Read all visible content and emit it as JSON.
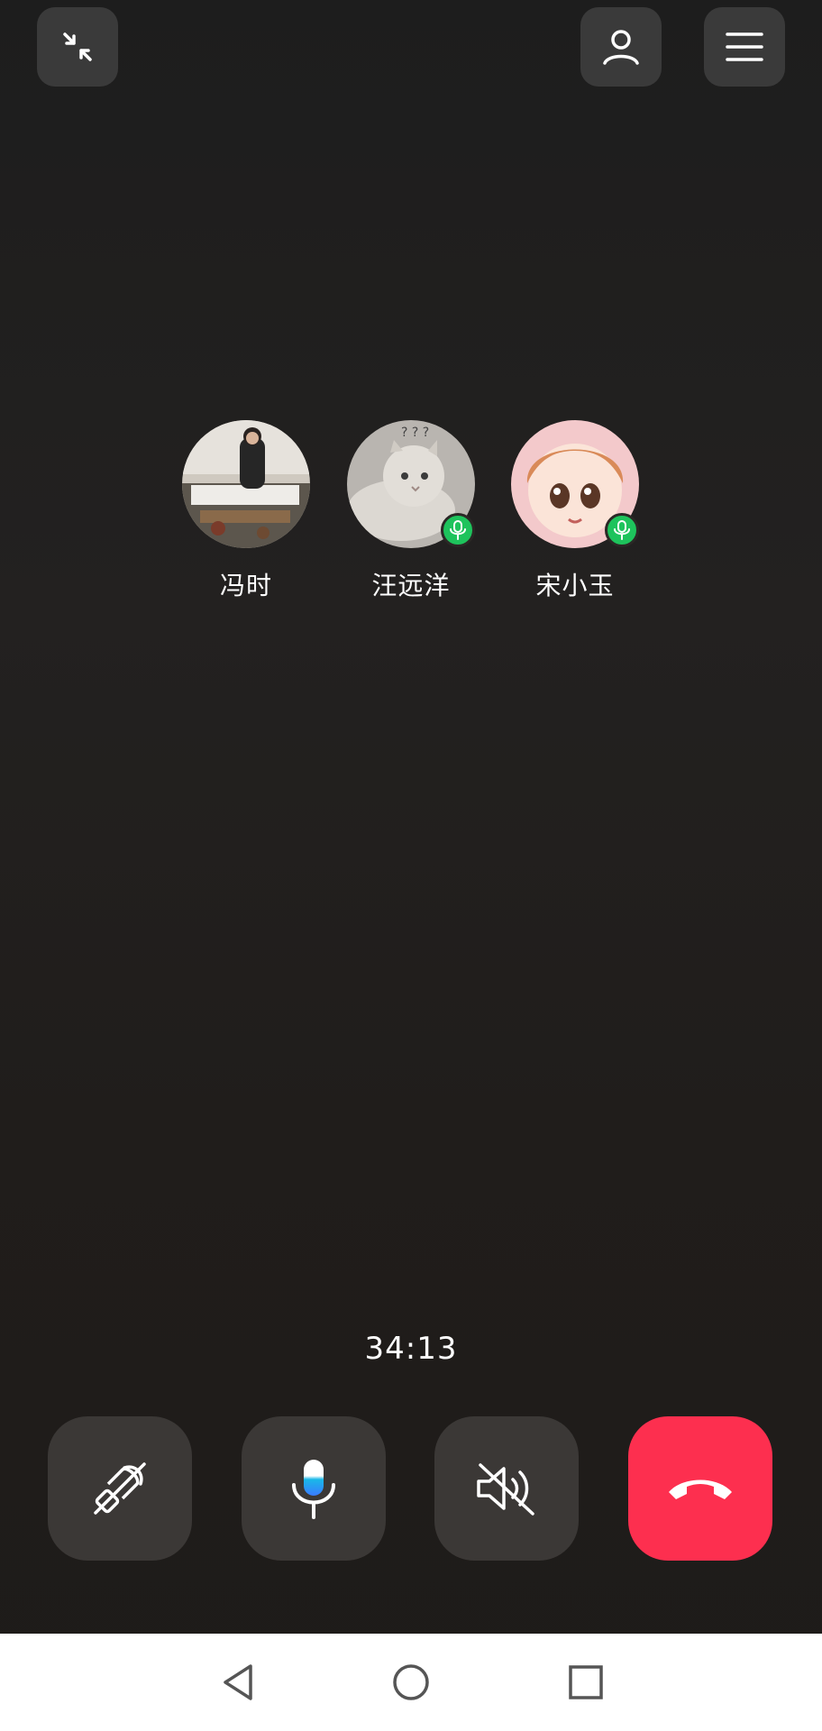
{
  "top_bar": {
    "minimize_icon": "minimize-arrows-icon",
    "contacts_icon": "person-icon",
    "menu_icon": "hamburger-menu-icon"
  },
  "participants": [
    {
      "name": "冯时",
      "mic_on": false
    },
    {
      "name": "汪远洋",
      "mic_on": true
    },
    {
      "name": "宋小玉",
      "mic_on": true
    }
  ],
  "call": {
    "duration": "34:13"
  },
  "controls": {
    "speaker_off_icon": "speaker-off-icon",
    "mic_icon": "microphone-icon",
    "mute_audio_icon": "volume-muted-icon",
    "hangup_icon": "hang-up-icon",
    "hangup_color": "#fd2f4f",
    "mic_active_color": "#19b8e8"
  },
  "colors": {
    "background": "#201d1b",
    "button_bg": "#3b3836",
    "mic_badge": "#1ec35c"
  }
}
